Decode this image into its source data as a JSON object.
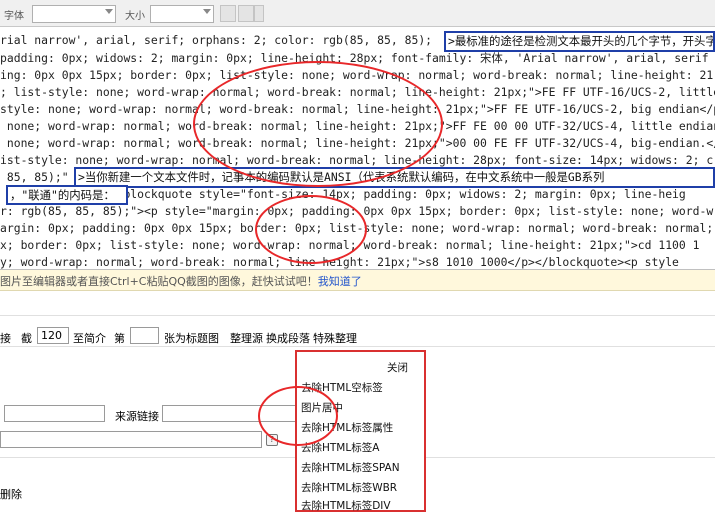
{
  "toolbar": {
    "font_label": "字体",
    "size_label": "大小"
  },
  "editor": {
    "lines": [
      "rial narrow', arial, serif; orphans: 2; color: rgb(85, 85, 85); ",
      "padding: 0px; widows: 2; margin: 0px; line-height: 28px; font-family: 宋体, 'Arial narrow', arial, serif",
      "ing: 0px 0px 15px; border: 0px; list-style: none; word-wrap: normal; word-break: normal; line-height: 21",
      "; list-style: none; word-wrap: normal; word-break: normal; line-height: 21px;\">FE FF UTF-16/UCS-2, little",
      "style: none; word-wrap: normal; word-break: normal; line-height: 21px;\">FF FE UTF-16/UCS-2, big endian</p",
      " none; word-wrap: normal; word-break: normal; line-height: 21px;\">FF FE 00 00 UTF-32/UCS-4, little endian",
      " none; word-wrap: normal; word-break: normal; line-height: 21px;\">00 00 FE FF UTF-32/UCS-4, big-endian.</",
      "ist-style: none; word-wrap: normal; word-break: normal; line-height: 28px; font-size: 14px; widows: 2; c",
      " 85, 85);\"",
      "              /p><blockquote style=\"font-size: 14px; padding: 0px; widows: 2; margin: 0px; line-heig",
      "r: rgb(85, 85, 85);\"><p style=\"margin: 0px; padding: 0px 0px 15px; border: 0px; list-style: none; word-w",
      "argin: 0px; padding: 0px 0px 15px; border: 0px; list-style: none; word-wrap: normal; word-break: normal;",
      "x; border: 0px; list-style: none; word-wrap: normal; word-break: normal; line-height: 21px;\">cd 1100 1",
      "y; word-wrap: normal; word-break: normal; line-height: 21px;\">s8 1010 1000</p></blockquote><p style"
    ],
    "highlight1": ">最标准的途径是检测文本最开头的几个字节，开头字",
    "highlight2": ">当你新建一个文本文件时，记事本的编码默认是ANSI（代表系统默认编码，在中文系统中一般是GB系列",
    "highlight3": "，\"联通\"的内码是："
  },
  "hint": {
    "text": "图片至编辑器或者直接Ctrl+C粘贴QQ截图的图像，赶快试试吧！",
    "link": "我知道了"
  },
  "options": {
    "prefix": "接",
    "cut_label": "截",
    "cut_value": "120",
    "summary_label": "至简介",
    "page_label": "第",
    "page_value": "",
    "title_img_label": "张为标题图"
  },
  "actions": {
    "tidy_source": "整理源",
    "change_paragraph": "换成段落",
    "special_tidy": "特殊整理"
  },
  "menu": {
    "close": "关闭",
    "items": [
      "去除HTML空标签",
      "图片居中",
      "去除HTML标签属性",
      "去除HTML标签A",
      "去除HTML标签SPAN",
      "去除HTML标签WBR",
      "去除HTML标签DIV"
    ]
  },
  "form": {
    "source_link_label": "来源链接",
    "delete_label": "删除"
  },
  "colors": {
    "highlight_border": "#1f3fa8",
    "annotation_red": "#e8282a",
    "hint_bg": "#fff8dc",
    "link_blue": "#2255cc"
  }
}
